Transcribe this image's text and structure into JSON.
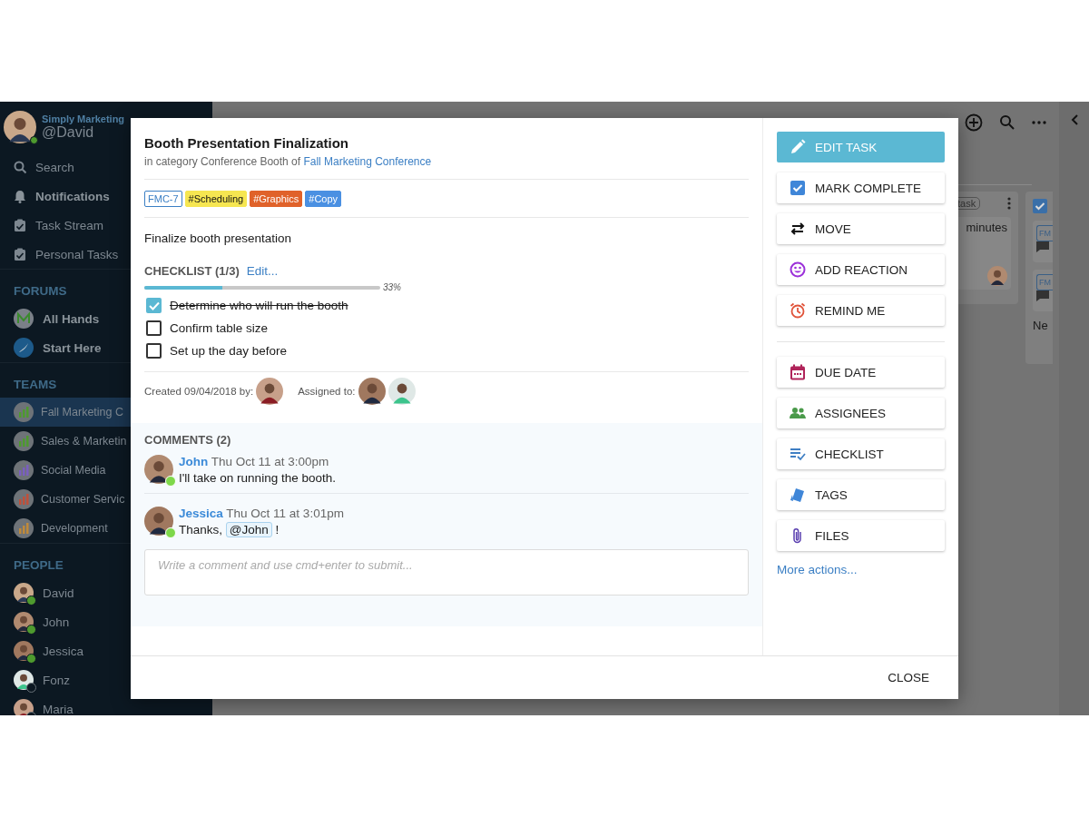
{
  "sidebar": {
    "workspace": "Simply Marketing",
    "user": "@David",
    "online": true,
    "nav": [
      {
        "label": "Search",
        "unread": false
      },
      {
        "label": "Notifications",
        "unread": true
      },
      {
        "label": "Task Stream",
        "unread": false
      },
      {
        "label": "Personal Tasks",
        "unread": false
      }
    ],
    "sections": [
      {
        "title": "FORUMS",
        "kind": "forum",
        "items": [
          {
            "label": "All Hands"
          },
          {
            "label": "Start Here"
          }
        ]
      },
      {
        "title": "TEAMS",
        "kind": "team",
        "items": [
          {
            "label": "Fall Marketing C",
            "selected": true
          },
          {
            "label": "Sales & Marketin",
            "selected": false
          },
          {
            "label": "Social Media",
            "selected": false
          },
          {
            "label": "Customer Servic",
            "selected": false
          },
          {
            "label": "Development",
            "selected": false
          }
        ]
      },
      {
        "title": "PEOPLE",
        "kind": "person",
        "items": [
          {
            "label": "David",
            "online": true
          },
          {
            "label": "John",
            "online": true
          },
          {
            "label": "Jessica",
            "online": true
          },
          {
            "label": "Fonz",
            "online": false
          },
          {
            "label": "Maria",
            "online": false
          }
        ]
      }
    ]
  },
  "board": {
    "chip": "task",
    "card_text": "minutes",
    "codes": [
      "FM",
      "FM"
    ],
    "footer": "Ne"
  },
  "modal": {
    "title": "Booth Presentation Finalization",
    "category": "in category Conference Booth of",
    "project": "Fall Marketing Conference",
    "tags": [
      {
        "label": "FMC-7",
        "kind": "outline",
        "color": "#3b7fc4"
      },
      {
        "label": "#Scheduling",
        "kind": "filled",
        "color": "#f6e651"
      },
      {
        "label": "#Graphics",
        "kind": "filled",
        "color": "#e0622a"
      },
      {
        "label": "#Copy",
        "kind": "filled",
        "color": "#4a90e2"
      }
    ],
    "description": "Finalize booth presentation",
    "checklist": {
      "title": "CHECKLIST (1/3)",
      "edit": "Edit...",
      "level": 0.33,
      "reading": "33%",
      "items": [
        {
          "text": "Determine who will run the booth",
          "checked": true
        },
        {
          "text": "Confirm table size",
          "checked": false
        },
        {
          "text": "Set up the day before",
          "checked": false
        }
      ]
    },
    "created": "Created 09/04/2018 by:",
    "assigned": "Assigned to:",
    "comments_title": "COMMENTS (2)",
    "comments": [
      {
        "author": "John",
        "time": "Thu Oct 11 at 3:00pm",
        "online": true,
        "segments": [
          {
            "kind": "text",
            "text": "I'll take on running the booth."
          }
        ]
      },
      {
        "author": "Jessica",
        "time": "Thu Oct 11 at 3:01pm",
        "online": true,
        "segments": [
          {
            "kind": "text",
            "text": "Thanks, "
          },
          {
            "kind": "mention",
            "text": "@John"
          },
          {
            "kind": "text",
            "text": " !"
          }
        ]
      }
    ],
    "comment_placeholder": "Write a comment and use cmd+enter to submit...",
    "action_groups": [
      {
        "items": [
          {
            "label": "EDIT TASK",
            "kind": "primary"
          },
          {
            "label": "MARK COMPLETE",
            "kind": "secondary"
          },
          {
            "label": "MOVE",
            "kind": "secondary"
          },
          {
            "label": "ADD REACTION",
            "kind": "secondary"
          },
          {
            "label": "REMIND ME",
            "kind": "secondary"
          }
        ]
      },
      {
        "items": [
          {
            "label": "DUE DATE",
            "kind": "secondary"
          },
          {
            "label": "ASSIGNEES",
            "kind": "secondary"
          },
          {
            "label": "CHECKLIST",
            "kind": "secondary"
          },
          {
            "label": "TAGS",
            "kind": "secondary"
          },
          {
            "label": "FILES",
            "kind": "secondary"
          }
        ]
      }
    ],
    "more_actions": "More actions...",
    "close": "CLOSE"
  }
}
